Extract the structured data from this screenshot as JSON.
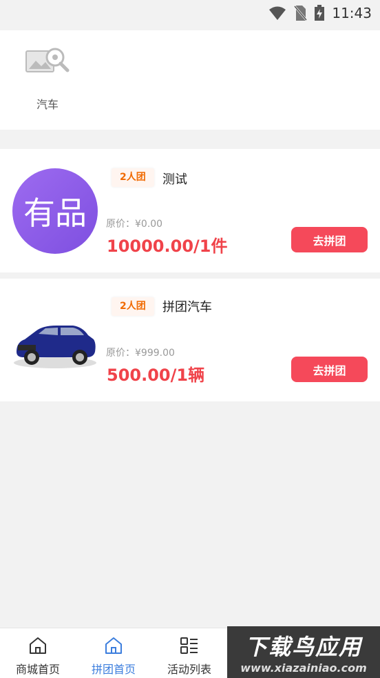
{
  "status_bar": {
    "time": "11:43"
  },
  "categories": [
    {
      "label": "汽车"
    }
  ],
  "products": [
    {
      "badge": "2人团",
      "name": "测试",
      "original_price": "原价：¥0.00",
      "price": "10000.00/1件",
      "button": "去拼团",
      "thumb_text": "有品"
    },
    {
      "badge": "2人团",
      "name": "拼团汽车",
      "original_price": "原价：¥999.00",
      "price": "500.00/1辆",
      "button": "去拼团"
    }
  ],
  "tabs": [
    {
      "label": "商城首页",
      "icon": "home-icon"
    },
    {
      "label": "拼团首页",
      "icon": "home-icon",
      "active": true
    },
    {
      "label": "活动列表",
      "icon": "list-icon"
    }
  ],
  "watermark": {
    "title": "下载鸟应用",
    "url": "www.xiazainiao.com"
  },
  "colors": {
    "accent": "#3b7ddd",
    "price": "#f0434a",
    "button": "#f5495a",
    "badge_text": "#f06a00"
  }
}
